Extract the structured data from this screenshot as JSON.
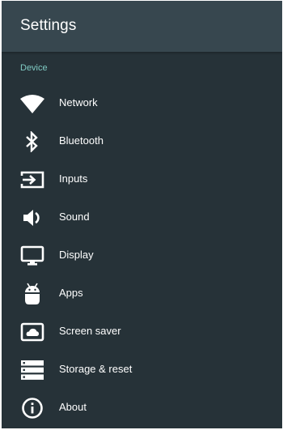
{
  "header": {
    "title": "Settings"
  },
  "section": {
    "label": "Device"
  },
  "items": [
    {
      "label": "Network",
      "icon": "wifi-icon"
    },
    {
      "label": "Bluetooth",
      "icon": "bluetooth-icon"
    },
    {
      "label": "Inputs",
      "icon": "input-icon"
    },
    {
      "label": "Sound",
      "icon": "volume-icon"
    },
    {
      "label": "Display",
      "icon": "monitor-icon"
    },
    {
      "label": "Apps",
      "icon": "android-icon"
    },
    {
      "label": "Screen saver",
      "icon": "screensaver-icon"
    },
    {
      "label": "Storage & reset",
      "icon": "storage-icon"
    },
    {
      "label": "About",
      "icon": "info-icon"
    }
  ],
  "colors": {
    "background": "#263238",
    "header": "#37474f",
    "section_label": "#80cbc4",
    "text": "#ffffff"
  }
}
